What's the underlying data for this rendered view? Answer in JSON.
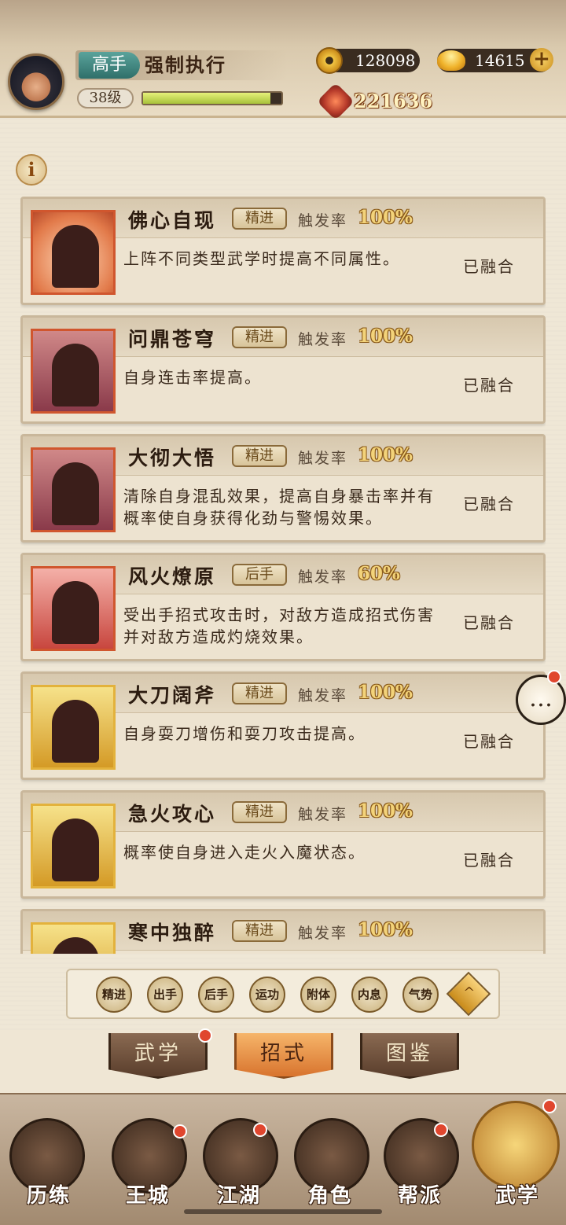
{
  "header": {
    "rank": "高手",
    "name": "强制执行",
    "level": "38级",
    "exp_fraction": 0.92,
    "coins": "128098",
    "ingots": "14615",
    "power": "221636"
  },
  "info_icon": "i",
  "cards": [
    {
      "title": "佛心自现",
      "tag": "精进",
      "rate_label": "触发率",
      "rate": "100%",
      "desc": "上阵不同类型武学时提高不同属性。",
      "status": "已融合",
      "art": "praying-hands-icon"
    },
    {
      "title": "问鼎苍穹",
      "tag": "精进",
      "rate_label": "触发率",
      "rate": "100%",
      "desc": "自身连击率提高。",
      "status": "已融合",
      "art": "swordsman-silhouette-icon"
    },
    {
      "title": "大彻大悟",
      "tag": "精进",
      "rate_label": "触发率",
      "rate": "100%",
      "desc": "清除自身混乱效果，提高自身暴击率并有概率使自身获得化劲与警惕效果。",
      "status": "已融合",
      "art": "meditating-figure-icon"
    },
    {
      "title": "风火燎原",
      "tag": "后手",
      "rate_label": "触发率",
      "rate": "60%",
      "desc": "受出手招式攻击时，对敌方造成招式伤害并对敌方造成灼烧效果。",
      "status": "已融合",
      "art": "fire-clouds-icon"
    },
    {
      "title": "大刀阔斧",
      "tag": "精进",
      "rate_label": "触发率",
      "rate": "100%",
      "desc": "自身耍刀增伤和耍刀攻击提高。",
      "status": "已融合",
      "art": "blade-warrior-icon"
    },
    {
      "title": "急火攻心",
      "tag": "精进",
      "rate_label": "触发率",
      "rate": "100%",
      "desc": "概率使自身进入走火入魔状态。",
      "status": "已融合",
      "art": "flexing-figure-icon"
    },
    {
      "title": "寒中独醉",
      "tag": "精进",
      "rate_label": "触发率",
      "rate": "100%",
      "desc": "",
      "status": "",
      "art": "drinking-figure-icon"
    }
  ],
  "filters": [
    {
      "label": "精进"
    },
    {
      "label": "出手"
    },
    {
      "label": "后手"
    },
    {
      "label": "运功"
    },
    {
      "label": "附体"
    },
    {
      "label": "内息"
    },
    {
      "label": "气势"
    }
  ],
  "filter_up_icon": "^",
  "tabs": [
    {
      "label": "武学"
    },
    {
      "label": "招式"
    },
    {
      "label": "图鉴"
    }
  ],
  "nav": [
    {
      "label": "历练"
    },
    {
      "label": "王城"
    },
    {
      "label": "江湖"
    },
    {
      "label": "角色"
    },
    {
      "label": "帮派"
    },
    {
      "label": "武学"
    }
  ],
  "chat_icon": "…",
  "colors": {
    "accent": "#d8742e",
    "rate": "#f3d37a",
    "badge_red": "#e0462e"
  }
}
